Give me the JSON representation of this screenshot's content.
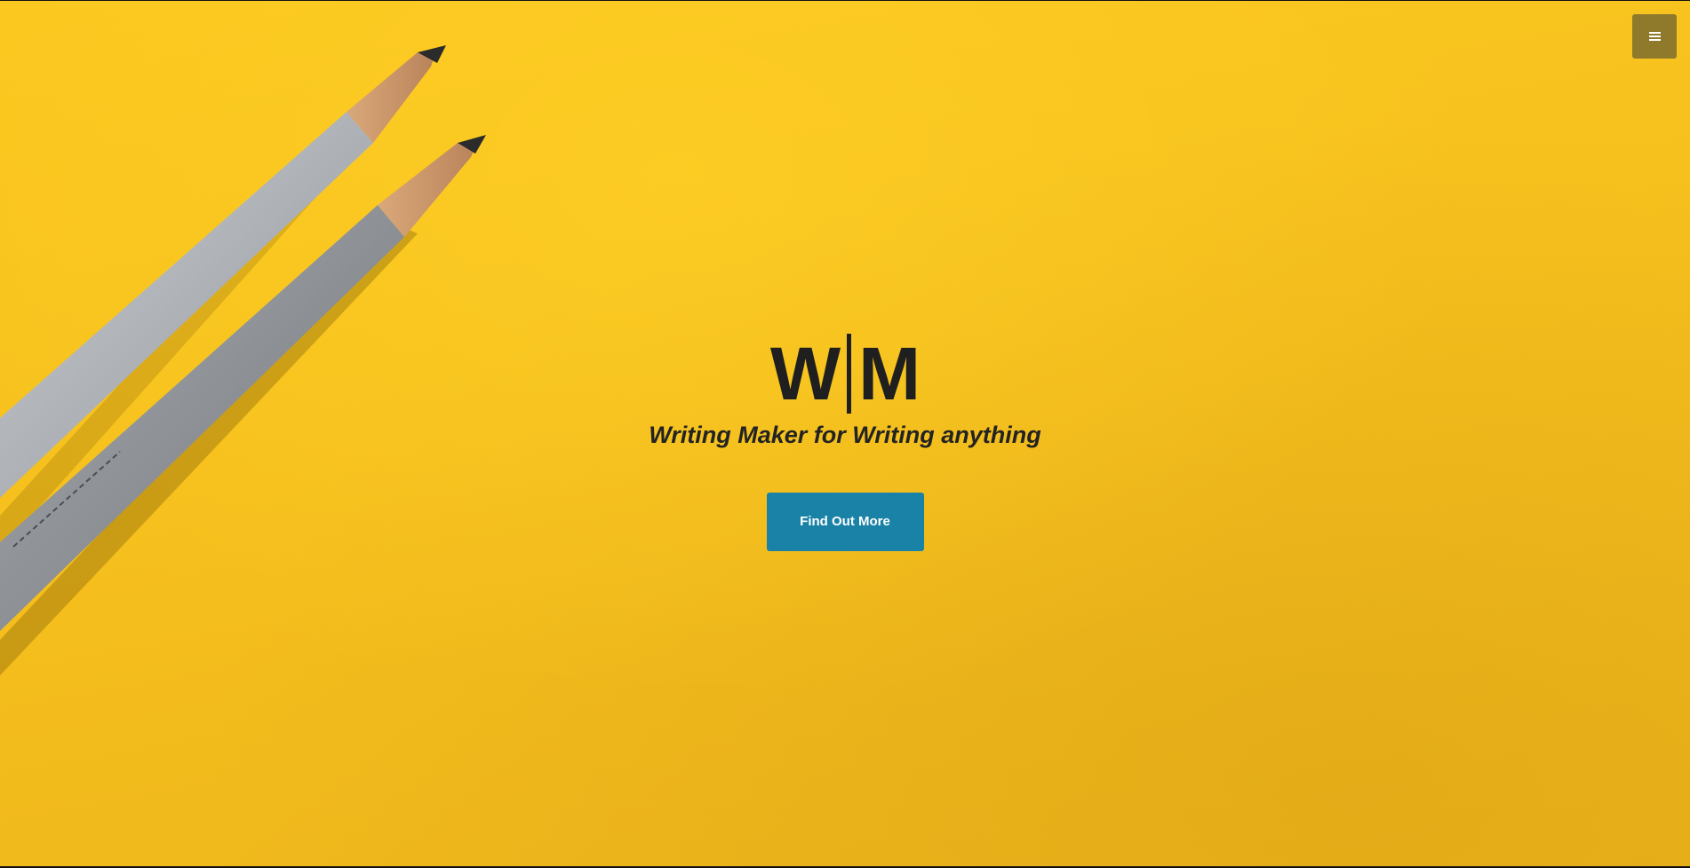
{
  "menu": {
    "icon": "hamburger-menu-icon"
  },
  "hero": {
    "logo_left": "W",
    "logo_right": "M",
    "tagline": "Writing Maker for Writing anything",
    "cta_label": "Find Out More",
    "background_image": "two-pencils-on-yellow-paper"
  },
  "colors": {
    "background": "#f6c01d",
    "menu_button": "#8f7a2c",
    "cta_button": "#1b82a7",
    "text_dark": "#1f1f1f"
  }
}
